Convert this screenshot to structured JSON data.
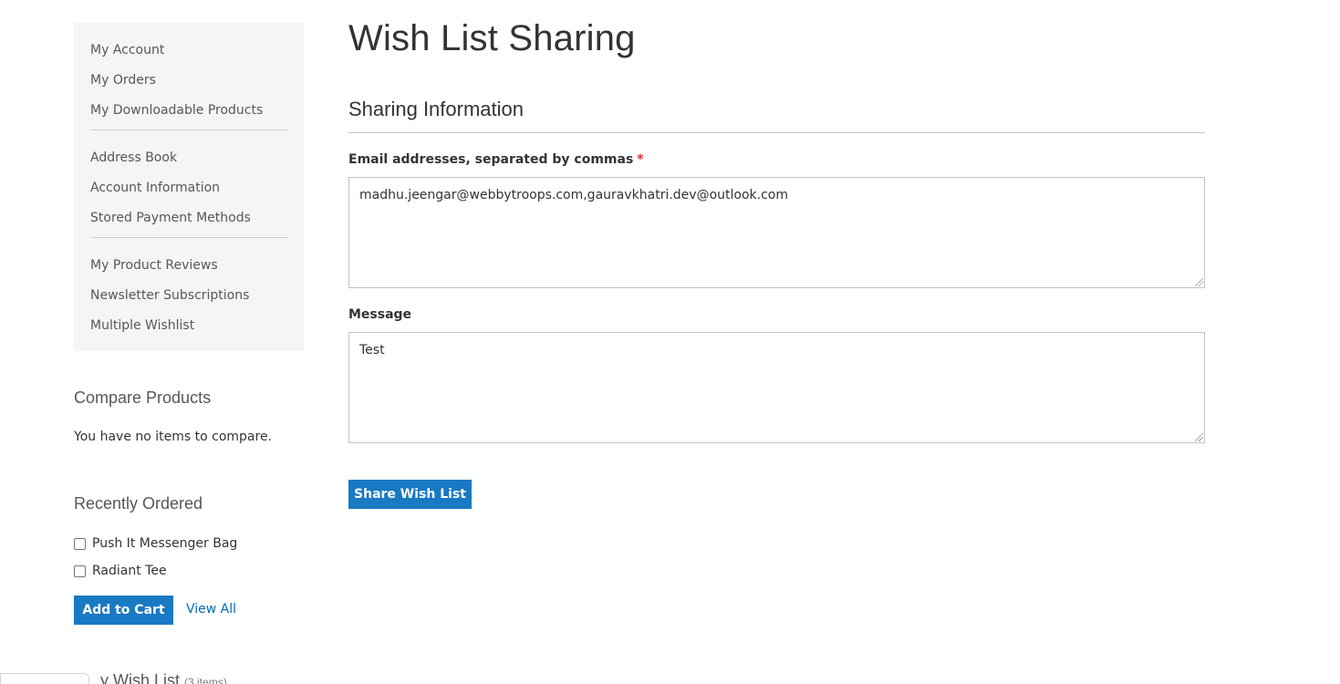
{
  "sidebar": {
    "groups": [
      [
        "My Account",
        "My Orders",
        "My Downloadable Products"
      ],
      [
        "Address Book",
        "Account Information",
        "Stored Payment Methods"
      ],
      [
        "My Product Reviews",
        "Newsletter Subscriptions",
        "Multiple Wishlist"
      ]
    ]
  },
  "compare": {
    "title": "Compare Products",
    "empty_text": "You have no items to compare."
  },
  "recently_ordered": {
    "title": "Recently Ordered",
    "items": [
      "Push It Messenger Bag",
      "Radiant Tee"
    ],
    "add_to_cart_label": "Add to Cart",
    "view_all_label": "View All"
  },
  "wishlist_block": {
    "title_partial": "y Wish List",
    "count": "(3 items)"
  },
  "main": {
    "page_title": "Wish List Sharing",
    "section_title": "Sharing Information",
    "email_label": "Email addresses, separated by commas",
    "required_mark": "*",
    "email_value": "madhu.jeengar@webbytroops.com,gauravkhatri.dev@outlook.com",
    "message_label": "Message",
    "message_value": "Test",
    "share_button_label": "Share Wish List"
  },
  "colors": {
    "primary": "#1979c3",
    "link": "#006bb4",
    "required": "#e02b27",
    "sidebar_bg": "#f5f5f5"
  }
}
